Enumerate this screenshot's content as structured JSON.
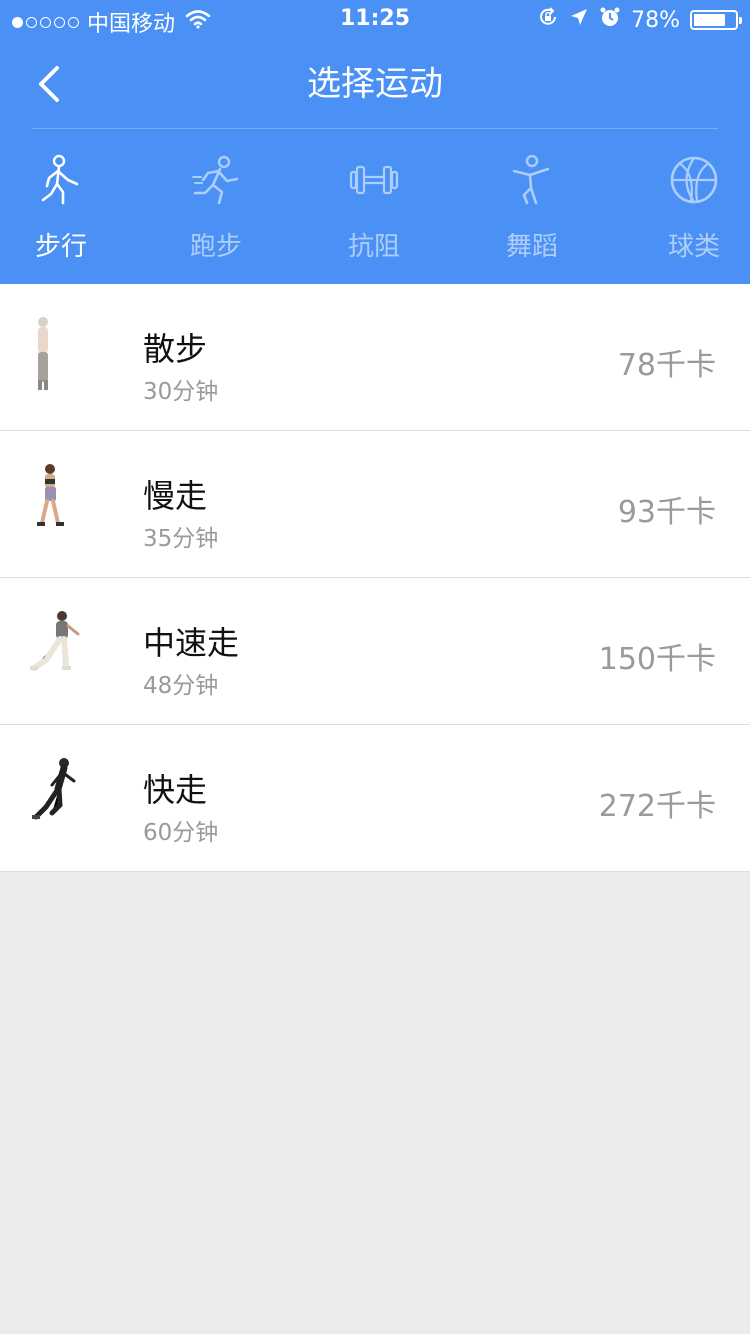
{
  "status_bar": {
    "carrier": "中国移动",
    "time": "11:25",
    "battery": "78%",
    "battery_level": 0.78,
    "signal_bars_filled": 1,
    "signal_bars_total": 5
  },
  "nav": {
    "title": "选择运动",
    "back_icon": "chevron-left-icon"
  },
  "categories": [
    {
      "label": "步行",
      "icon": "walking-icon",
      "selected": true
    },
    {
      "label": "跑步",
      "icon": "running-icon",
      "selected": false
    },
    {
      "label": "抗阻",
      "icon": "dumbbell-icon",
      "selected": false
    },
    {
      "label": "舞蹈",
      "icon": "dance-icon",
      "selected": false
    },
    {
      "label": "球类",
      "icon": "basketball-icon",
      "selected": false
    }
  ],
  "activities": [
    {
      "name": "散步",
      "duration": "30分钟",
      "calories": "78千卡"
    },
    {
      "name": "慢走",
      "duration": "35分钟",
      "calories": "93千卡"
    },
    {
      "name": "中速走",
      "duration": "48分钟",
      "calories": "150千卡"
    },
    {
      "name": "快走",
      "duration": "60分钟",
      "calories": "272千卡"
    }
  ],
  "colors": {
    "header_blue": "#4a90f5",
    "background": "#ececec",
    "secondary_text": "#9a9a9a"
  }
}
